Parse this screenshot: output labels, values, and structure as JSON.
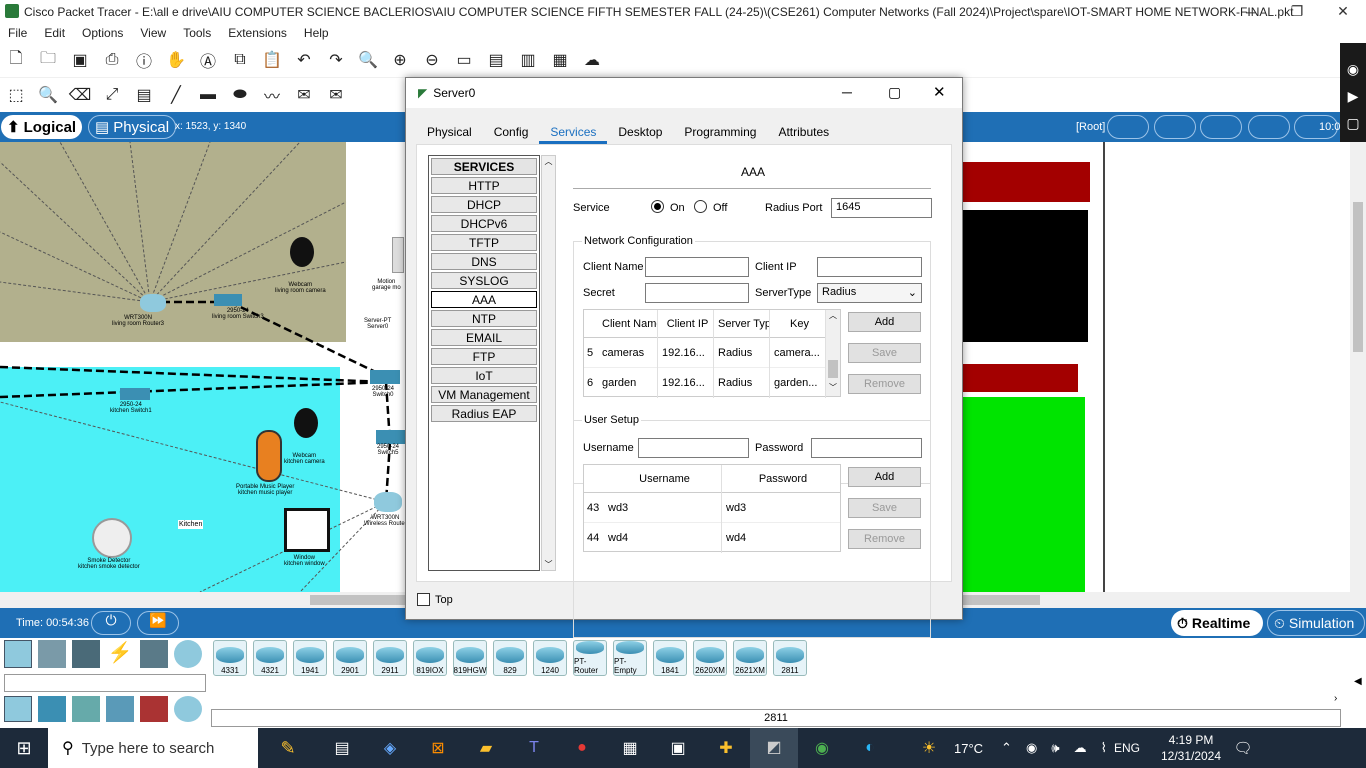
{
  "window": {
    "title": "Cisco Packet Tracer - E:\\all e drive\\AIU COMPUTER SCIENCE BACLERIOS\\AIU COMPUTER SCIENCE FIFTH SEMESTER FALL (24-25)\\(CSE261) Computer Networks (Fall 2024)\\Project\\spare\\IOT-SMART HOME NETWORK-FINAL.pkt"
  },
  "menu": [
    "File",
    "Edit",
    "Options",
    "View",
    "Tools",
    "Extensions",
    "Help"
  ],
  "viewbar": {
    "logical": "Logical",
    "physical": "Physical",
    "coords": "x: 1523, y: 1340",
    "root": "[Root]",
    "time_partial": "10:0"
  },
  "bottombar": {
    "time": "Time: 00:54:36",
    "realtime": "Realtime",
    "simulation": "Simulation"
  },
  "palette": {
    "devices": [
      "4331",
      "4321",
      "1941",
      "2901",
      "2911",
      "819IOX",
      "819HGW",
      "829",
      "1240",
      "PT-Router",
      "PT-Empty",
      "1841",
      "2620XM",
      "2621XM",
      "2811"
    ],
    "selected_label": "2811"
  },
  "canvas_labels": {
    "router1": "WRT300N\nliving room Router3",
    "switch3": "2950-24\nliving room Switch3",
    "webcam1": "Webcam\nliving room camera",
    "switch1": "2950-24\nkitchen Switch1",
    "switch0": "2950-24\nSwitch0",
    "switch5": "2950-24\nSwitch5",
    "webcam2": "Webcam\nkitchen camera",
    "player": "Portable Music Player\nkitchen music player",
    "kitchen": "Kitchen",
    "smoke": "Smoke Detector\nkitchen smoke detector",
    "window": "Window\nkitchen window",
    "router2": "WRT300N\nWireless Router",
    "motion": "Motion\ngarage mo",
    "server": "Server-PT\nServer0"
  },
  "taskbar": {
    "search": "Type here to search",
    "weather": "17°C",
    "lang": "ENG",
    "time": "4:19 PM",
    "date": "12/31/2024"
  },
  "dialog": {
    "title": "Server0",
    "tabs": [
      "Physical",
      "Config",
      "Services",
      "Desktop",
      "Programming",
      "Attributes"
    ],
    "services_header": "SERVICES",
    "services": [
      "HTTP",
      "DHCP",
      "DHCPv6",
      "TFTP",
      "DNS",
      "SYSLOG",
      "AAA",
      "NTP",
      "EMAIL",
      "FTP",
      "IoT",
      "VM Management",
      "Radius EAP"
    ],
    "panel_title": "AAA",
    "service_label": "Service",
    "on": "On",
    "off": "Off",
    "radius_port_label": "Radius Port",
    "radius_port": "1645",
    "net_group": "Network Configuration",
    "client_name_label": "Client Name",
    "client_ip_label": "Client IP",
    "secret_label": "Secret",
    "server_type_label": "ServerType",
    "server_type": "Radius",
    "client_cols": [
      "Client Name",
      "Client IP",
      "Server Type",
      "Key"
    ],
    "client_rows": [
      {
        "n": "5",
        "name": "cameras",
        "ip": "192.16...",
        "type": "Radius",
        "key": "camera..."
      },
      {
        "n": "6",
        "name": "garden",
        "ip": "192.16...",
        "type": "Radius",
        "key": "garden..."
      }
    ],
    "add": "Add",
    "save": "Save",
    "remove": "Remove",
    "user_group": "User Setup",
    "username_label": "Username",
    "password_label": "Password",
    "user_cols": [
      "Username",
      "Password"
    ],
    "user_rows": [
      {
        "n": "43",
        "u": "wd3",
        "p": "wd3"
      },
      {
        "n": "44",
        "u": "wd4",
        "p": "wd4"
      }
    ],
    "top_label": "Top"
  }
}
